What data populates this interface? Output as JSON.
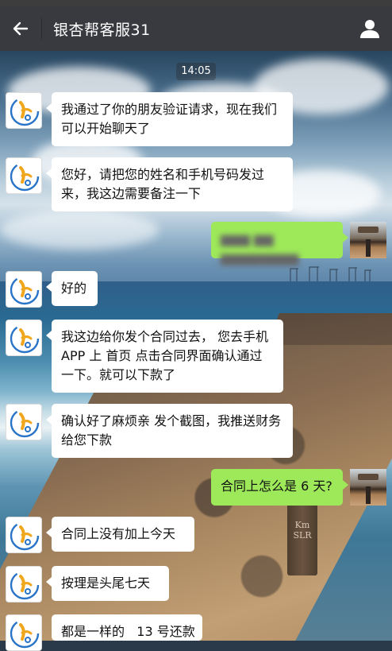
{
  "header": {
    "title": "银杏帮客服31",
    "back_icon": "arrow-left-icon",
    "profile_icon": "person-icon",
    "background": "#393a3f"
  },
  "timestamp": "14:05",
  "background": {
    "post_text": "Km\nSLR"
  },
  "messages": [
    {
      "side": "left",
      "text": "我通过了你的朋友验证请求，现在我们可以开始聊天了"
    },
    {
      "side": "left",
      "text": "您好，请把您的姓名和手机号码发过来，我这边需要备注一下"
    },
    {
      "side": "right",
      "text": "▆▆▆ ▆▆ ▆▆▆▆▆▆▆▆",
      "blurred": true
    },
    {
      "side": "left",
      "text": "好的"
    },
    {
      "side": "left",
      "text": "我这边给你发个合同过去， 您去手机APP 上 首页 点击合同界面确认通过一下。就可以下款了"
    },
    {
      "side": "left",
      "text": "确认好了麻烦亲 发个截图，我推送财务给您下款"
    },
    {
      "side": "right",
      "text": "合同上怎么是 6 天?"
    },
    {
      "side": "left",
      "text": "合同上没有加上今天"
    },
    {
      "side": "left",
      "text": "按理是头尾七天"
    },
    {
      "side": "left",
      "text": "都是一样的   13 号还款"
    }
  ],
  "colors": {
    "bubble_left": "#ffffff",
    "bubble_right": "#9ee95a"
  }
}
